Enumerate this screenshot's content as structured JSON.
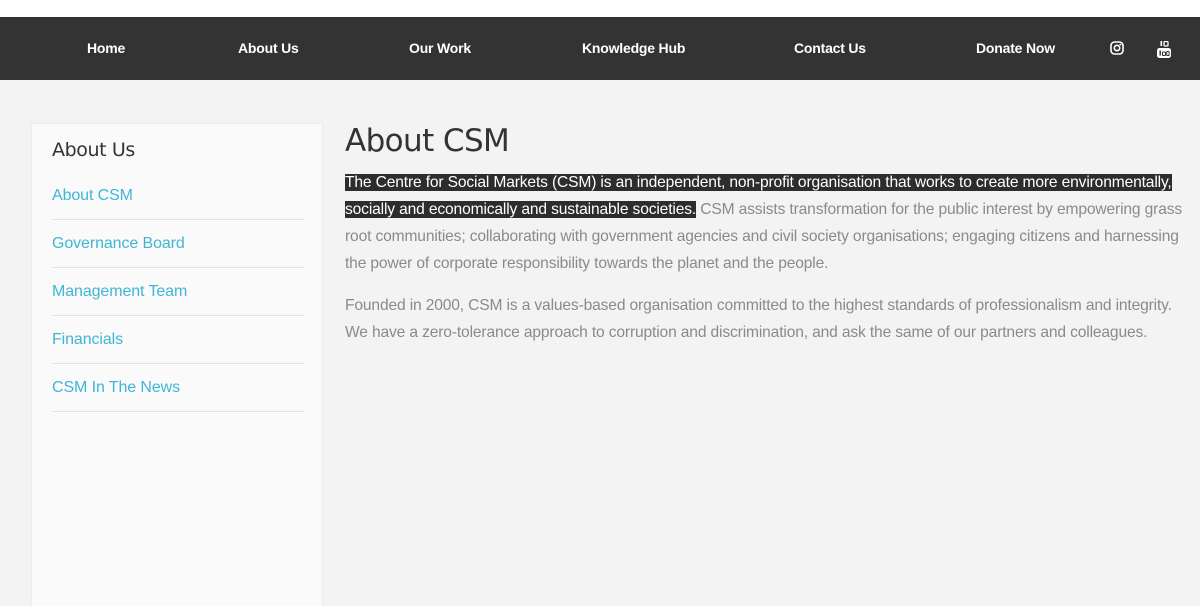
{
  "nav": {
    "items": [
      {
        "label": "Home"
      },
      {
        "label": "About Us"
      },
      {
        "label": "Our Work"
      },
      {
        "label": "Knowledge Hub"
      },
      {
        "label": "Contact Us"
      },
      {
        "label": "Donate Now"
      }
    ],
    "icons": [
      "instagram-icon",
      "youtube-icon"
    ]
  },
  "sidebar": {
    "title": "About Us",
    "items": [
      {
        "label": "About CSM"
      },
      {
        "label": "Governance Board"
      },
      {
        "label": "Management Team"
      },
      {
        "label": "Financials"
      },
      {
        "label": "CSM In The News"
      }
    ]
  },
  "main": {
    "title": "About CSM",
    "para1_highlighted": "The Centre for Social Markets (CSM) is an independent, non-profit organisation that works to create more environmentally, socially and economically and sustainable societies.",
    "para1_rest": " CSM assists transformation for the public interest by empowering grass root communities; collaborating with government agencies and civil society organisations; engaging citizens and harnessing the power of corporate responsibility towards the planet and the people.",
    "para2": "Founded in 2000, CSM is a values-based organisation committed to the highest standards of professionalism and integrity. We have a zero-tolerance approach to corruption and discrimination, and ask the same of our partners and colleagues."
  },
  "colors": {
    "nav_bg": "#333333",
    "link": "#3fb6d6",
    "highlight_bg": "#2d2d2d",
    "body_text": "#8a8a8a"
  }
}
